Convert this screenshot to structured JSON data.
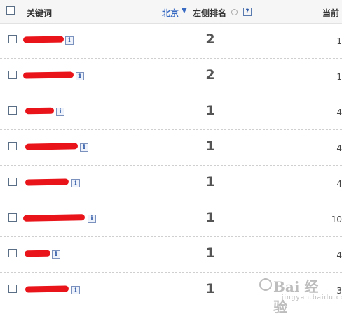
{
  "header": {
    "keyword_label": "关键词",
    "city_label": "北京",
    "sort_arrow": "▼",
    "left_rank_label": "左侧排名",
    "help_glyph": "?",
    "current_label": "当前"
  },
  "info_glyph": "i",
  "rows": [
    {
      "rank": "2",
      "right_value": "1"
    },
    {
      "rank": "2",
      "right_value": "1"
    },
    {
      "rank": "1",
      "right_value": "4"
    },
    {
      "rank": "1",
      "right_value": "4"
    },
    {
      "rank": "1",
      "right_value": "4"
    },
    {
      "rank": "1",
      "right_value": "10"
    },
    {
      "rank": "1",
      "right_value": "4"
    },
    {
      "rank": "1",
      "right_value": "3"
    }
  ],
  "watermark": {
    "brand": "Bai 经验",
    "domain": "jingyan.baidu.com"
  },
  "colors": {
    "redaction": "#e8141a",
    "header_bg": "#f6f6f6",
    "link_blue": "#3a6bc2"
  }
}
